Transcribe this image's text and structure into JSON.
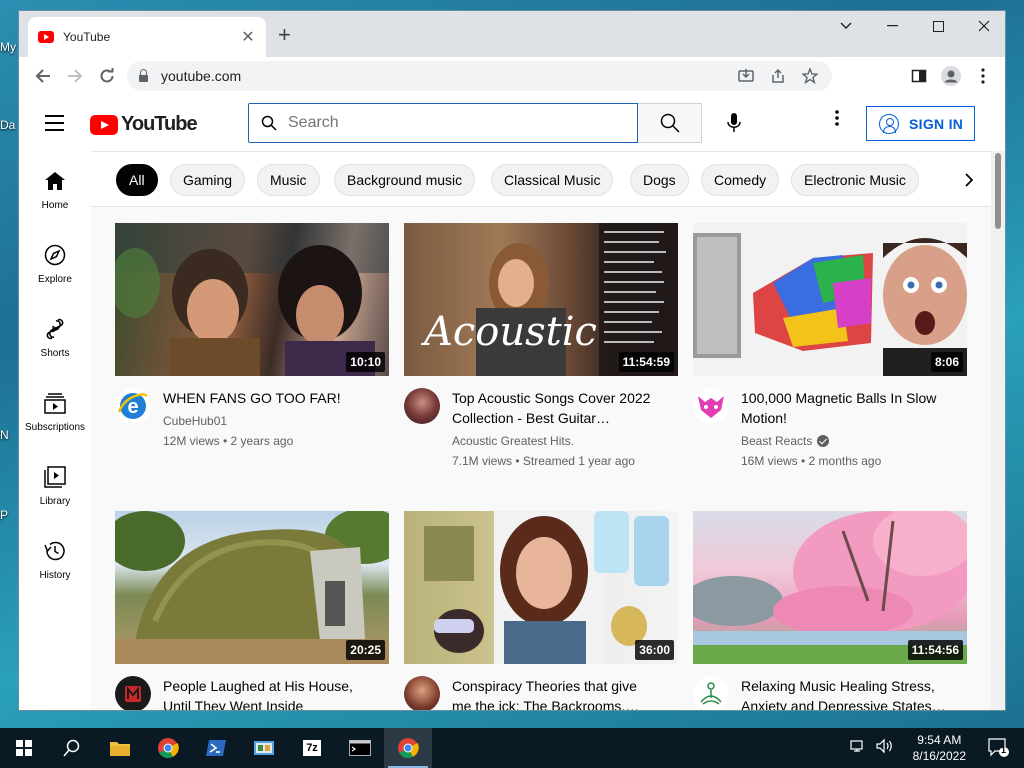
{
  "desktop": {
    "edge_labels": [
      "My",
      "Da",
      "N",
      "P"
    ]
  },
  "browser": {
    "tab_title": "YouTube",
    "tab_close": "✕",
    "new_tab": "+",
    "window_controls": {
      "minimize": "⌄",
      "maximize": "☐",
      "close": "✕",
      "extra": "—"
    },
    "url": "youtube.com"
  },
  "youtube": {
    "logo_text": "YouTube",
    "search_placeholder": "Search",
    "sign_in": "SIGN IN",
    "more_options": "⋮",
    "guide": [
      {
        "label": "Home",
        "icon": "home-icon"
      },
      {
        "label": "Explore",
        "icon": "compass-icon"
      },
      {
        "label": "Shorts",
        "icon": "shorts-icon"
      },
      {
        "label": "Subscriptions",
        "icon": "subscriptions-icon"
      },
      {
        "label": "Library",
        "icon": "library-icon"
      },
      {
        "label": "History",
        "icon": "history-icon"
      }
    ],
    "chips": [
      "All",
      "Gaming",
      "Music",
      "Background music",
      "Classical Music",
      "Dogs",
      "Comedy",
      "Electronic Music"
    ],
    "videos": [
      {
        "title_line1": "WHEN FANS GO TOO FAR!",
        "title_line2": "",
        "channel": "CubeHub01",
        "verified": false,
        "stats": "12M views • 2 years ago",
        "duration": "10:10"
      },
      {
        "title_line1": "Top Acoustic Songs Cover 2022",
        "title_line2": "Collection - Best Guitar…",
        "channel": "Acoustic Greatest Hits.",
        "verified": false,
        "stats": "7.1M views • Streamed 1 year ago",
        "duration": "11:54:59",
        "thumb_text": "Acoustic"
      },
      {
        "title_line1": "100,000 Magnetic Balls In Slow",
        "title_line2": "Motion!",
        "channel": "Beast Reacts",
        "verified": true,
        "stats": "16M views • 2 months ago",
        "duration": "8:06"
      },
      {
        "title_line1": "People Laughed at His House,",
        "title_line2": "Until They Went Inside",
        "channel": "",
        "verified": false,
        "stats": "",
        "duration": "20:25"
      },
      {
        "title_line1": "Conspiracy Theories that give",
        "title_line2": "me the ick: The Backrooms,…",
        "channel": "",
        "verified": false,
        "stats": "",
        "duration": "36:00"
      },
      {
        "title_line1": "Relaxing Music Healing Stress,",
        "title_line2": "Anxiety and Depressive States…",
        "channel": "",
        "verified": false,
        "stats": "",
        "duration": "11:54:56"
      }
    ]
  },
  "taskbar": {
    "time": "9:54 AM",
    "date": "8/16/2022",
    "notification_count": "1",
    "apps": [
      "start-icon",
      "search-icon",
      "file-explorer-icon",
      "chrome-icon",
      "powershell-icon",
      "control-panel-icon",
      "7zip-icon",
      "cmd-icon",
      "chrome-active-icon"
    ],
    "sevenzip_label": "7z"
  },
  "colors": {
    "accent": "#065fd4",
    "brand_red": "#ff0000",
    "search_border": "#1c62b9"
  }
}
